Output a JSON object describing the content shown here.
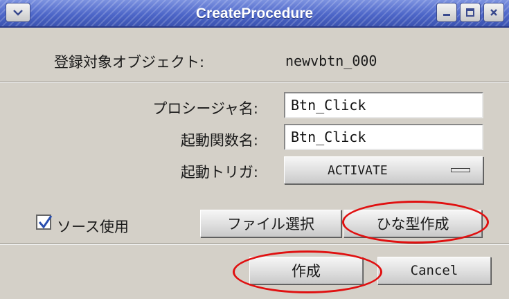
{
  "window": {
    "title": "CreateProcedure"
  },
  "target_object": {
    "label": "登録対象オブジェクト:",
    "value": "newvbtn_000"
  },
  "procedure_name": {
    "label": "プロシージャ名:",
    "value": "Btn_Click"
  },
  "start_function": {
    "label": "起動関数名:",
    "value": "Btn_Click"
  },
  "start_trigger": {
    "label": "起動トリガ:",
    "selected": "ACTIVATE"
  },
  "use_source": {
    "label": "ソース使用",
    "checked": true
  },
  "buttons": {
    "select_file": "ファイル選択",
    "create_template": "ひな型作成",
    "create": "作成",
    "cancel": "Cancel"
  },
  "colors": {
    "title_bar": "#4d66c8",
    "window_bg": "#d4d0c8",
    "highlight_ellipse": "#e01010"
  },
  "icons": {
    "window_menu": "chevron-down-icon",
    "minimize": "minimize-icon",
    "maximize": "maximize-icon",
    "close": "close-icon",
    "checkmark": "checkmark-icon"
  }
}
